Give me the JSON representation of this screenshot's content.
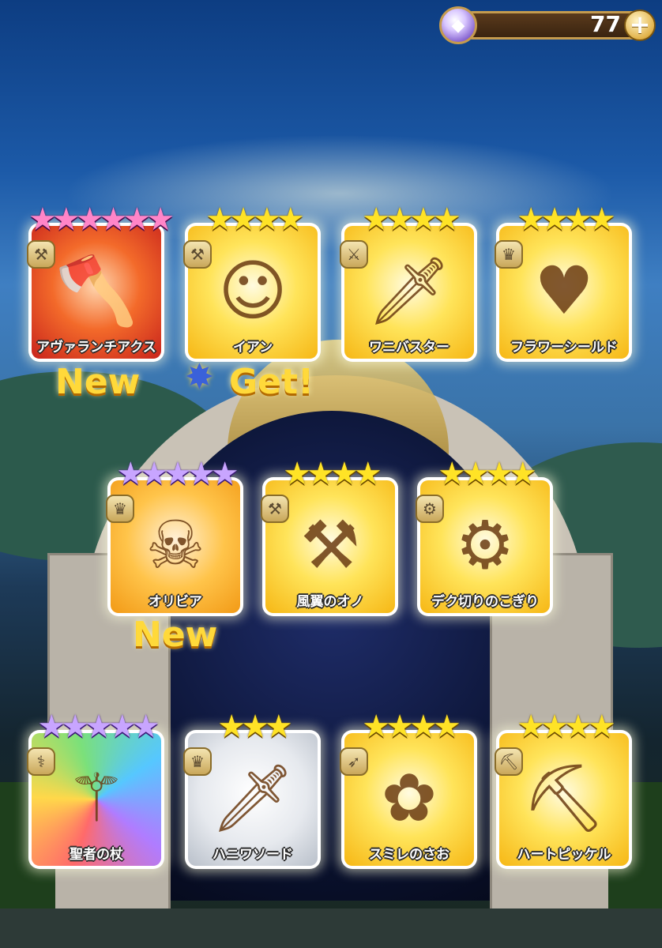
{
  "currency": {
    "icon": "diamond-gem-icon",
    "value": "77",
    "add_icon": "plus-icon"
  },
  "cards": [
    {
      "name": "アヴァランチアクス",
      "stars": 6,
      "star_color": "pink",
      "type_icon": "hammer-icon",
      "bg": "red",
      "art_icon": "axe-icon"
    },
    {
      "name": "イアン",
      "stars": 4,
      "star_color": "gold",
      "type_icon": "hammer-icon",
      "bg": "gold",
      "art_icon": "boy-character-icon"
    },
    {
      "name": "ワニバスター",
      "stars": 4,
      "star_color": "gold",
      "type_icon": "sword-icon",
      "bg": "gold",
      "art_icon": "crocodile-sword-icon"
    },
    {
      "name": "フラワーシールド",
      "stars": 4,
      "star_color": "gold",
      "type_icon": "crown-shield-icon",
      "bg": "gold",
      "art_icon": "heart-shield-icon"
    },
    {
      "name": "オリビア",
      "stars": 5,
      "star_color": "purple",
      "type_icon": "crown-shield-icon",
      "bg": "pirate",
      "art_icon": "pirate-girl-icon"
    },
    {
      "name": "風翼のオノ",
      "stars": 4,
      "star_color": "gold",
      "type_icon": "hammer-icon",
      "bg": "gold",
      "art_icon": "wind-axe-icon"
    },
    {
      "name": "デク切りのこぎり",
      "stars": 4,
      "star_color": "gold",
      "type_icon": "saw-icon",
      "bg": "gold",
      "art_icon": "saw-blade-icon"
    },
    {
      "name": "聖者の杖",
      "stars": 5,
      "star_color": "purple",
      "type_icon": "staff-icon",
      "bg": "rainbow",
      "art_icon": "winged-staff-icon"
    },
    {
      "name": "ハニワソード",
      "stars": 3,
      "star_color": "gold",
      "type_icon": "crown-shield-icon",
      "bg": "silver",
      "art_icon": "haniwa-sword-icon"
    },
    {
      "name": "スミレのさお",
      "stars": 4,
      "star_color": "gold",
      "type_icon": "bow-icon",
      "bg": "gold",
      "art_icon": "violet-rod-icon"
    },
    {
      "name": "ハートピッケル",
      "stars": 4,
      "star_color": "gold",
      "type_icon": "pickaxe-icon",
      "bg": "gold",
      "art_icon": "heart-pickaxe-icon"
    }
  ],
  "labels": {
    "new_1": "New",
    "get": "Get!",
    "new_2": "New"
  }
}
